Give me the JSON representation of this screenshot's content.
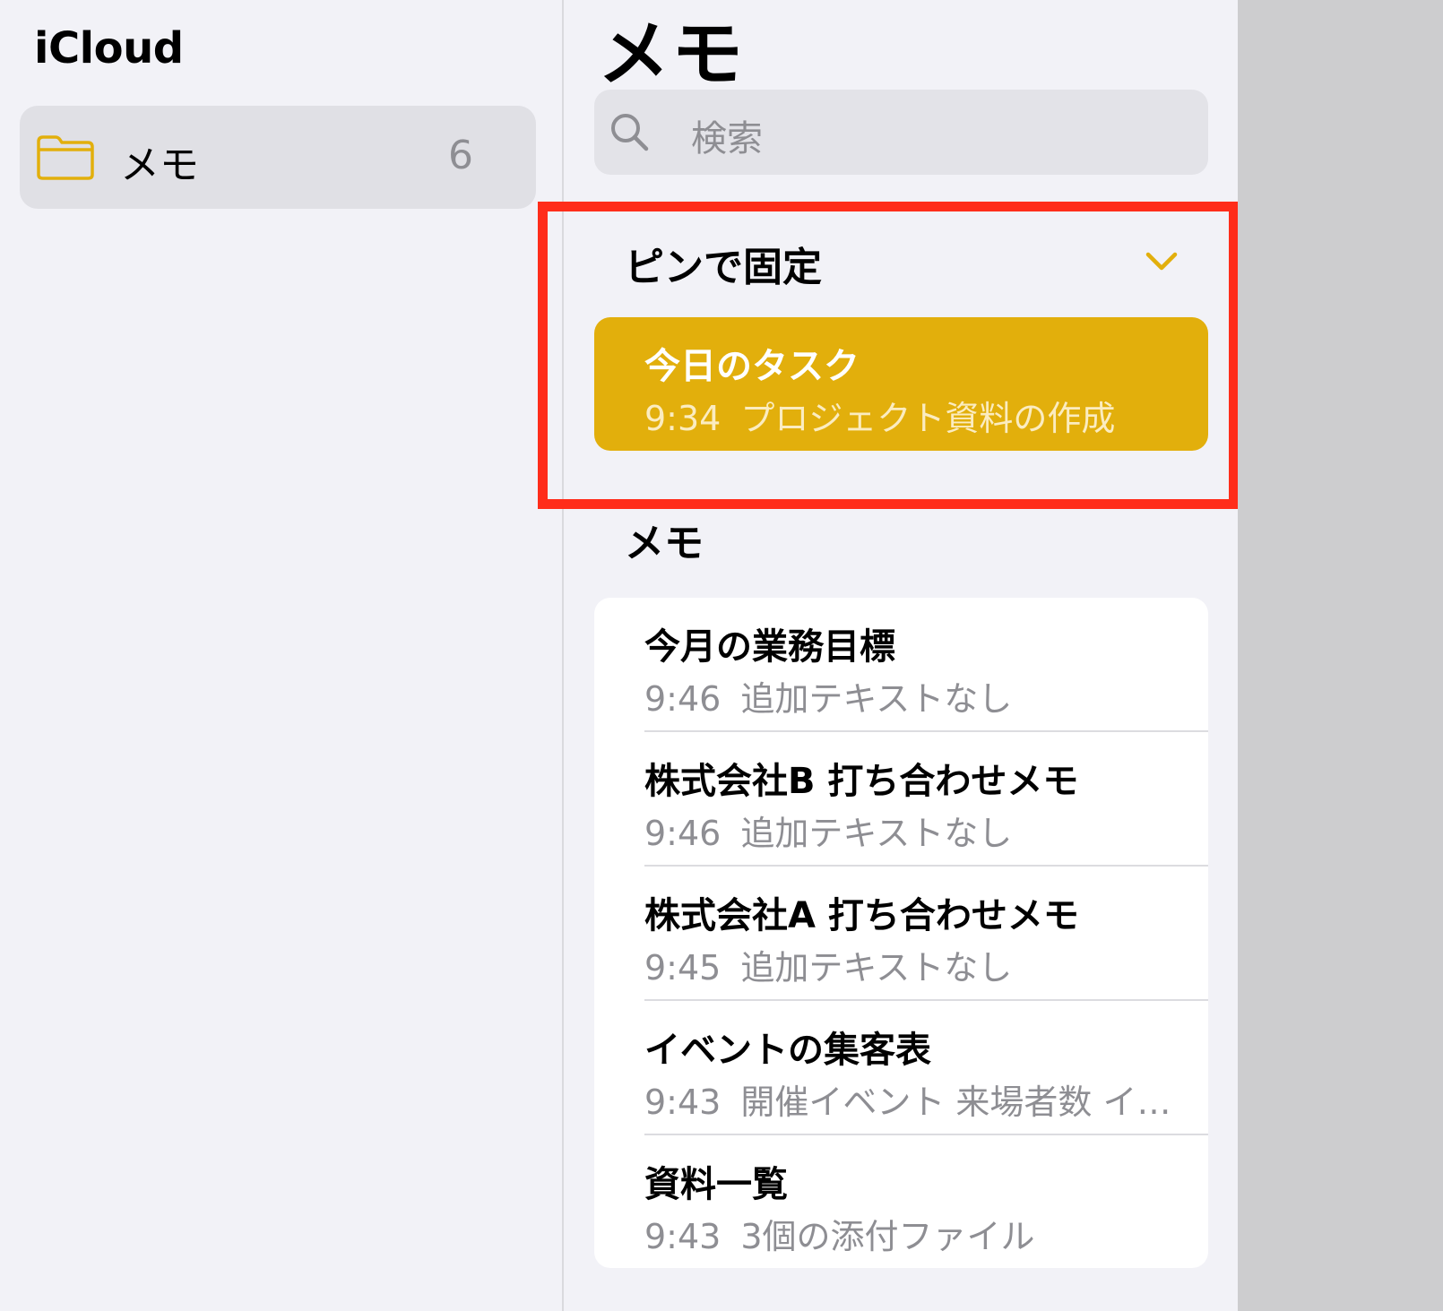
{
  "sidebar": {
    "account": "iCloud",
    "folders": [
      {
        "name": "メモ",
        "count": "6",
        "icon": "folder-icon"
      }
    ]
  },
  "list": {
    "title": "メモ",
    "search_placeholder": "検索",
    "pinned_section": "ピンで固定",
    "notes_section": "メモ",
    "pinned": [
      {
        "title": "今日のタスク",
        "time": "9:34",
        "preview": "プロジェクト資料の作成"
      }
    ],
    "notes": [
      {
        "title": "今月の業務目標",
        "time": "9:46",
        "preview": "追加テキストなし"
      },
      {
        "title": "株式会社B 打ち合わせメモ",
        "time": "9:46",
        "preview": "追加テキストなし"
      },
      {
        "title": "株式会社A 打ち合わせメモ",
        "time": "9:45",
        "preview": "追加テキストなし"
      },
      {
        "title": "イベントの集客表",
        "time": "9:43",
        "preview": "開催イベント 来場者数 イ…"
      },
      {
        "title": "資料一覧",
        "time": "9:43",
        "preview": "3個の添付ファイル"
      }
    ]
  },
  "colors": {
    "accent": "#e2af0c",
    "highlight": "#ff2d1a",
    "background": "#f2f2f7"
  }
}
